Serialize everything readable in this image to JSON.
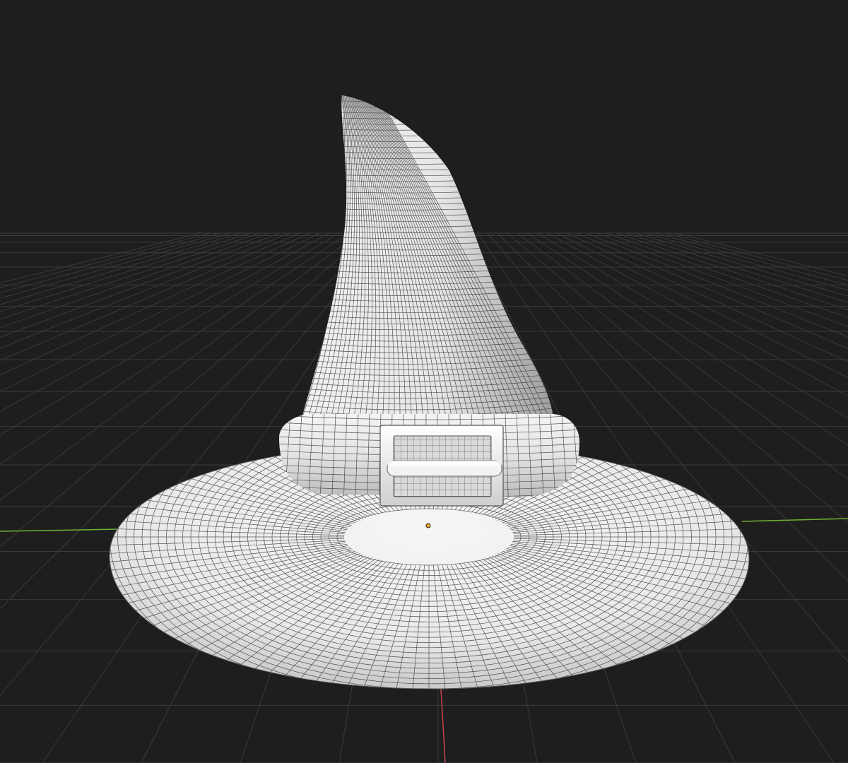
{
  "viewport": {
    "background_color": "#1e1e1e",
    "grid_line_color": "#3a3a3a",
    "axis_x_color": "#c8474b",
    "axis_y_color": "#6fb234",
    "mesh_fill_color": "#eeeeee",
    "mesh_wire_color": "#2f2f2f",
    "origin_color": "#f5a623"
  },
  "scene": {
    "object": "witch-hat",
    "parts": [
      "brim",
      "band",
      "cone",
      "buckle"
    ],
    "display_mode": "solid-with-wireframe-overlay"
  }
}
